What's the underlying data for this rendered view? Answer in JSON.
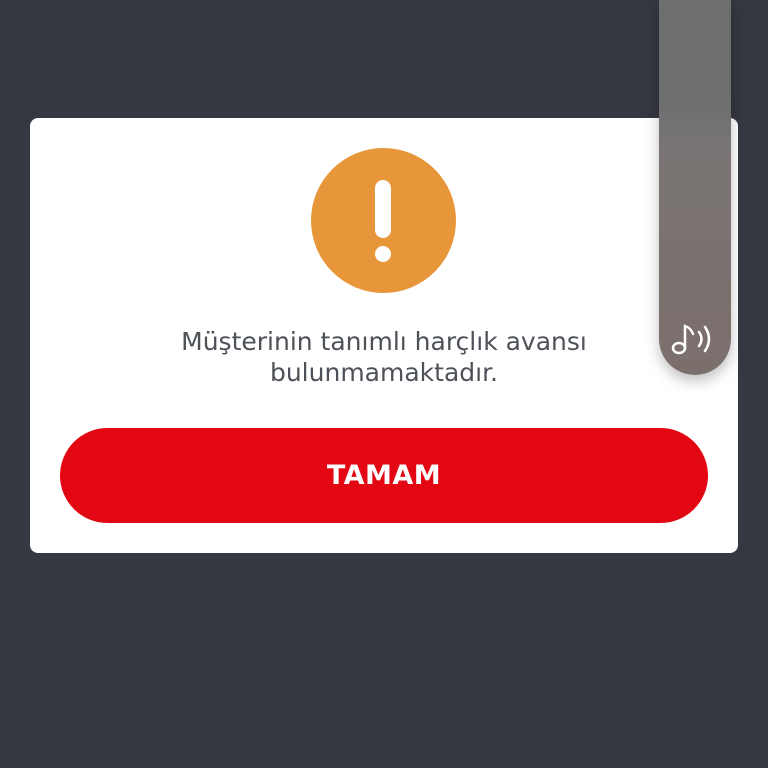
{
  "dialog": {
    "icon": "exclamation-warning-icon",
    "message_line1": "Müşterinin tanımlı harçlık avansı",
    "message_line2": "bulunmamaktadır.",
    "ok_label": "TAMAM"
  },
  "side_panel": {
    "icon": "music-sound-icon"
  },
  "colors": {
    "backdrop": "#353840",
    "dialog_bg": "#ffffff",
    "warning": "#e8963a",
    "button": "#e30613",
    "text": "#4d5158"
  }
}
